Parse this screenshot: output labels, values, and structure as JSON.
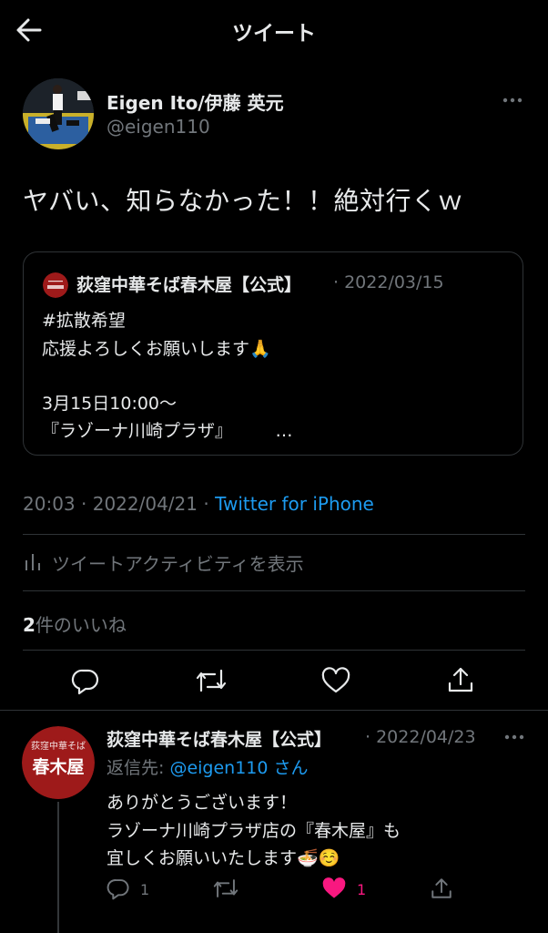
{
  "header": {
    "title": "ツイート"
  },
  "tweet": {
    "author_name": "Eigen Ito/伊藤 英元",
    "author_handle": "@eigen110",
    "text": "ヤバい、知らなかった！！絶対行くｗ",
    "time": "20:03",
    "date": "2022/04/21",
    "source": "Twitter for iPhone",
    "activity_label": "ツイートアクティビティを表示",
    "likes_count": "2",
    "likes_label": "件のいいね"
  },
  "quote": {
    "author_name": "荻窪中華そば春木屋【公式】",
    "date": "2022/03/15",
    "lines": [
      "#拡散希望",
      "応援よろしくお願いします🙏",
      "",
      "3月15日10:00～",
      "『ラゾーナ川崎プラザ』　　　…"
    ]
  },
  "reply": {
    "author_name": "荻窪中華そば春木屋【公式】",
    "date": "2022/04/23",
    "reply_to_label": "返信先: ",
    "reply_to_handle": "@eigen110",
    "reply_to_suffix": " さん",
    "lines": [
      "ありがとうございます！",
      "ラゾーナ川崎プラザ店の『春木屋』も",
      "宜しくお願いいたします🍜☺️"
    ],
    "reply_count": "1",
    "like_count": "1"
  },
  "logo": {
    "top_text": "荻窪中華そば",
    "main_text": "春木屋"
  },
  "colors": {
    "background": "#000000",
    "text": "#e7e9ea",
    "secondary": "#71767b",
    "link": "#1d9bf0",
    "like": "#f91880",
    "divider": "#2f3336",
    "logo_red": "#9e1a1a"
  }
}
